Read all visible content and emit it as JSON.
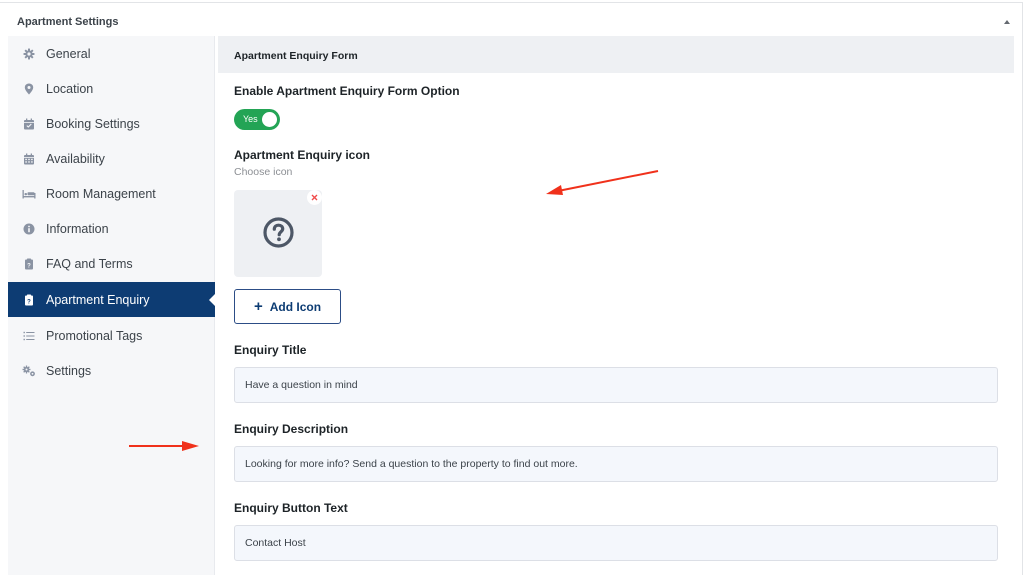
{
  "panel": {
    "title": "Apartment Settings",
    "collapse_icon": "triangle-up-icon"
  },
  "sidebar": {
    "items": [
      {
        "label": "General",
        "icon": "gear-icon",
        "active": false
      },
      {
        "label": "Location",
        "icon": "map-pin-icon",
        "active": false
      },
      {
        "label": "Booking Settings",
        "icon": "calendar-check-icon",
        "active": false
      },
      {
        "label": "Availability",
        "icon": "calendar-grid-icon",
        "active": false
      },
      {
        "label": "Room Management",
        "icon": "bed-icon",
        "active": false
      },
      {
        "label": "Information",
        "icon": "info-circle-icon",
        "active": false
      },
      {
        "label": "FAQ and Terms",
        "icon": "clipboard-question-icon",
        "active": false
      },
      {
        "label": "Apartment Enquiry",
        "icon": "clipboard-question-icon",
        "active": true
      },
      {
        "label": "Promotional Tags",
        "icon": "list-icon",
        "active": false
      },
      {
        "label": "Settings",
        "icon": "gears-icon",
        "active": false
      }
    ]
  },
  "main": {
    "section_title": "Apartment Enquiry Form",
    "enable_option": {
      "label": "Enable Apartment Enquiry Form Option",
      "toggle_text": "Yes",
      "enabled": true
    },
    "enquiry_icon": {
      "label": "Apartment Enquiry icon",
      "sublabel": "Choose icon",
      "preview_icon": "question-circle-icon",
      "remove_icon": "close-icon",
      "add_button": "Add Icon",
      "add_button_icon": "plus-icon"
    },
    "enquiry_title": {
      "label": "Enquiry Title",
      "value": "Have a question in mind"
    },
    "enquiry_description": {
      "label": "Enquiry Description",
      "value": "Looking for more info? Send a question to the property to find out more."
    },
    "enquiry_button_text": {
      "label": "Enquiry Button Text",
      "value": "Contact Host"
    }
  },
  "colors": {
    "active_nav": "#0d3c73",
    "toggle_on": "#23a455",
    "annotation_arrow": "#f0311b"
  }
}
